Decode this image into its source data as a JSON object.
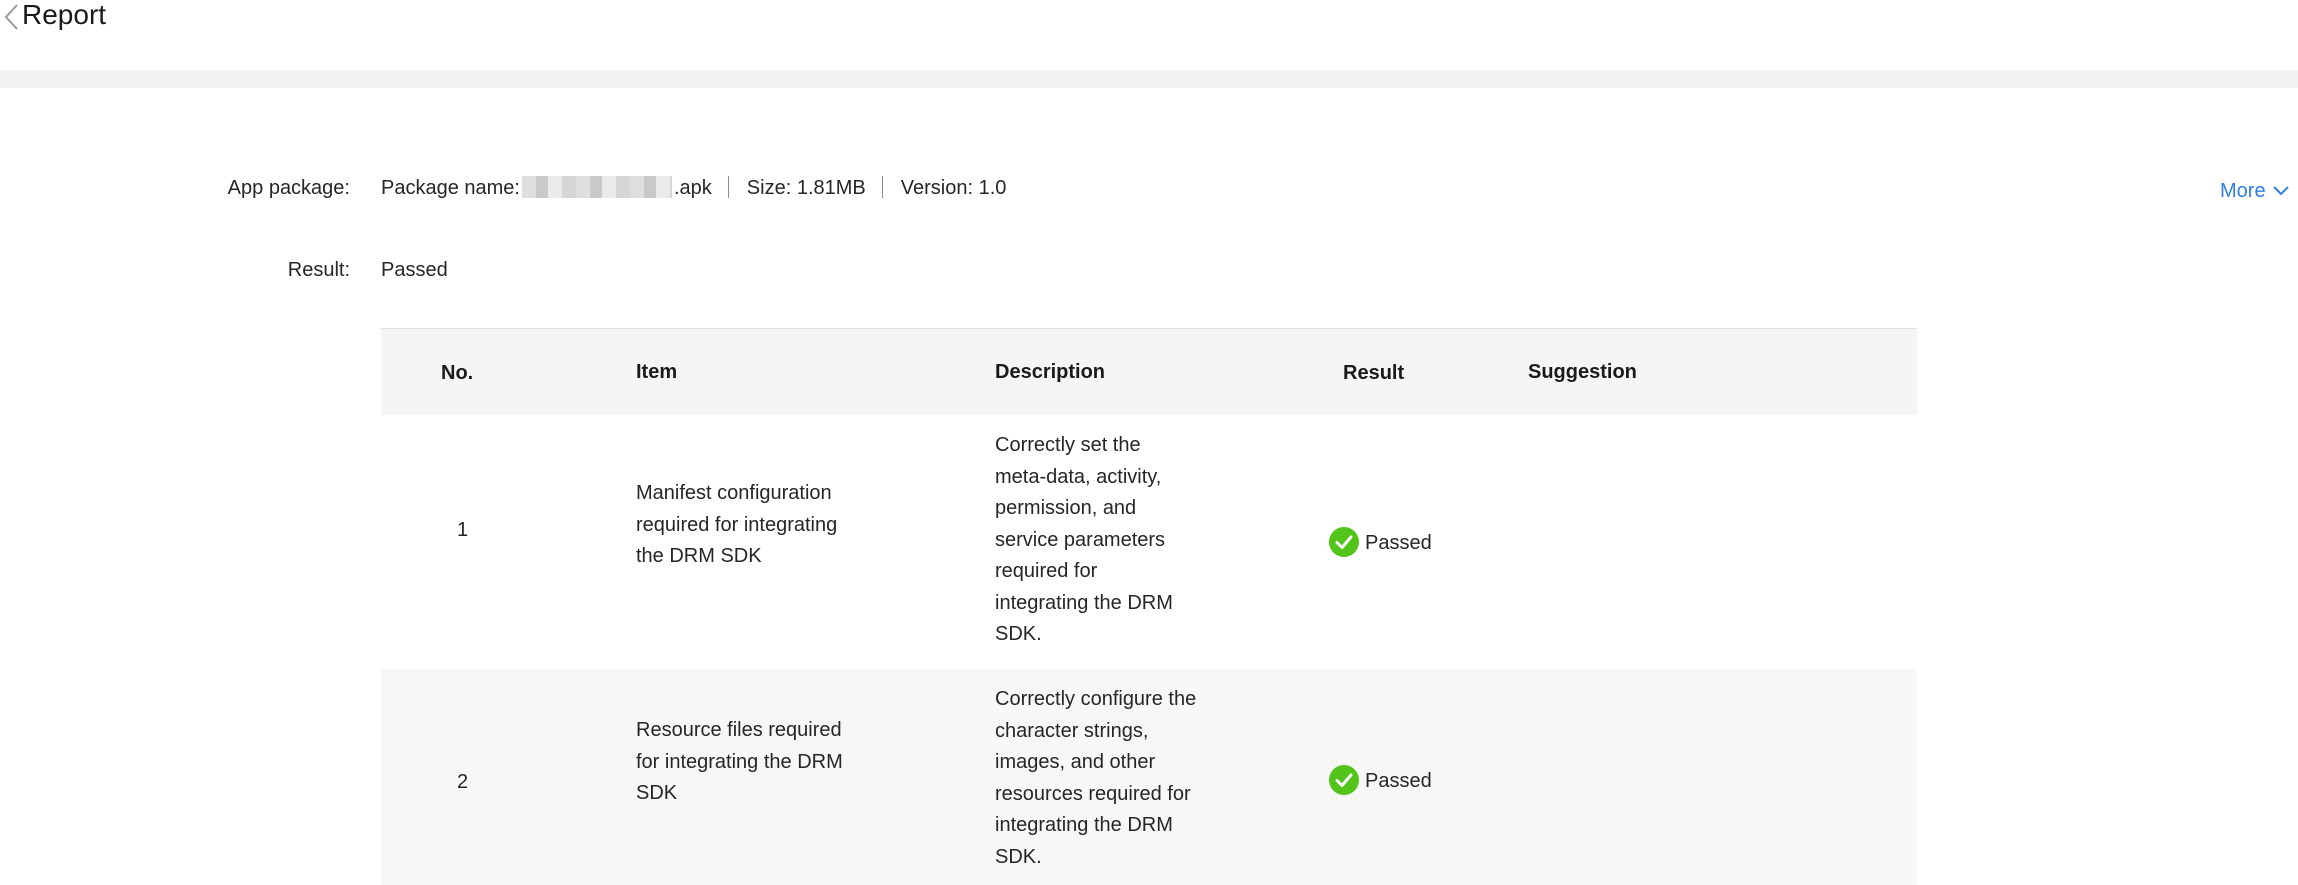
{
  "header": {
    "title": "Report"
  },
  "info": {
    "app_package_label": "App package:",
    "package_name_prefix": "Package name:",
    "package_name_suffix": ".apk",
    "size": "Size: 1.81MB",
    "version": "Version: 1.0",
    "result_label": "Result:",
    "result_value": "Passed",
    "more_label": "More"
  },
  "table": {
    "columns": [
      "No.",
      "Item",
      "Description",
      "Result",
      "Suggestion"
    ],
    "rows": [
      {
        "no": "1",
        "item": "Manifest configuration required for integrating the DRM SDK",
        "description": "Correctly set the meta-data, activity, permission, and service parameters required for integrating the DRM SDK.",
        "result": "Passed",
        "suggestion": ""
      },
      {
        "no": "2",
        "item": "Resource files required for integrating the DRM SDK",
        "description": "Correctly configure the character strings, images, and other resources required for integrating the DRM SDK.",
        "result": "Passed",
        "suggestion": ""
      }
    ]
  },
  "icons": {
    "back": "chevron-left-icon",
    "more": "chevron-down-icon",
    "passed": "check-circle-icon"
  },
  "colors": {
    "link": "#2f7de1",
    "passed": "#52c41a",
    "band": "#f2f2f2",
    "table_header": "#f5f5f5"
  }
}
